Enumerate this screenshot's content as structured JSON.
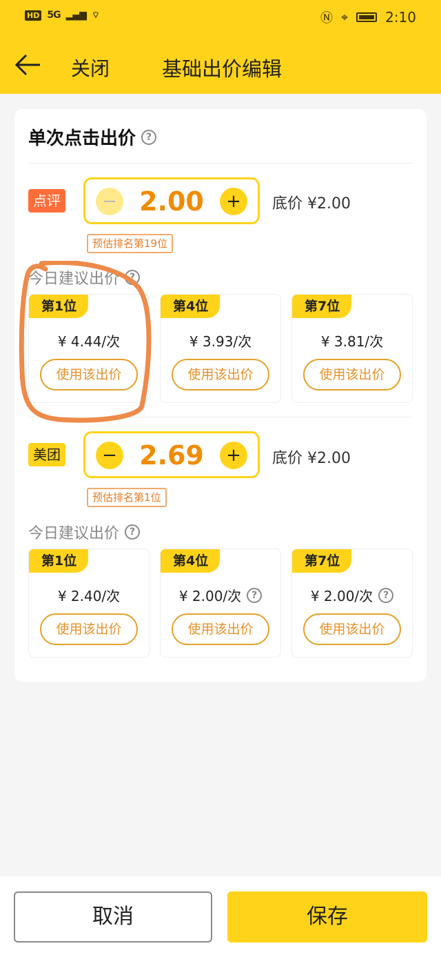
{
  "status_bar": {
    "hd": "HD",
    "network": "5G",
    "time": "2:10"
  },
  "header": {
    "close_label": "关闭",
    "title": "基础出价编辑"
  },
  "section": {
    "title": "单次点击出价"
  },
  "dianping": {
    "tag": "点评",
    "bid_value": "2.00",
    "floor_price": "底价 ¥2.00",
    "rank_estimate": "预估排名第19位",
    "suggest_label": "今日建议出价",
    "options": [
      {
        "rank": "第1位",
        "price": "¥ 4.44/次",
        "button": "使用该出价"
      },
      {
        "rank": "第4位",
        "price": "¥ 3.93/次",
        "button": "使用该出价"
      },
      {
        "rank": "第7位",
        "price": "¥ 3.81/次",
        "button": "使用该出价"
      }
    ]
  },
  "meituan": {
    "tag": "美团",
    "bid_value": "2.69",
    "floor_price": "底价 ¥2.00",
    "rank_estimate": "预估排名第1位",
    "suggest_label": "今日建议出价",
    "options": [
      {
        "rank": "第1位",
        "price": "¥ 2.40/次",
        "button": "使用该出价"
      },
      {
        "rank": "第4位",
        "price": "¥ 2.00/次",
        "button": "使用该出价"
      },
      {
        "rank": "第7位",
        "price": "¥ 2.00/次",
        "button": "使用该出价"
      }
    ]
  },
  "footer": {
    "cancel_label": "取消",
    "save_label": "保存"
  },
  "icons": {
    "back": "arrow-left-icon",
    "help": "question-circle-icon",
    "minus": "minus-icon",
    "plus": "plus-icon"
  },
  "colors": {
    "brand_yellow": "#ffd31a",
    "accent_orange": "#f08c00",
    "dianping_tag": "#ff6d3b",
    "annotation": "#ee8a4a"
  }
}
